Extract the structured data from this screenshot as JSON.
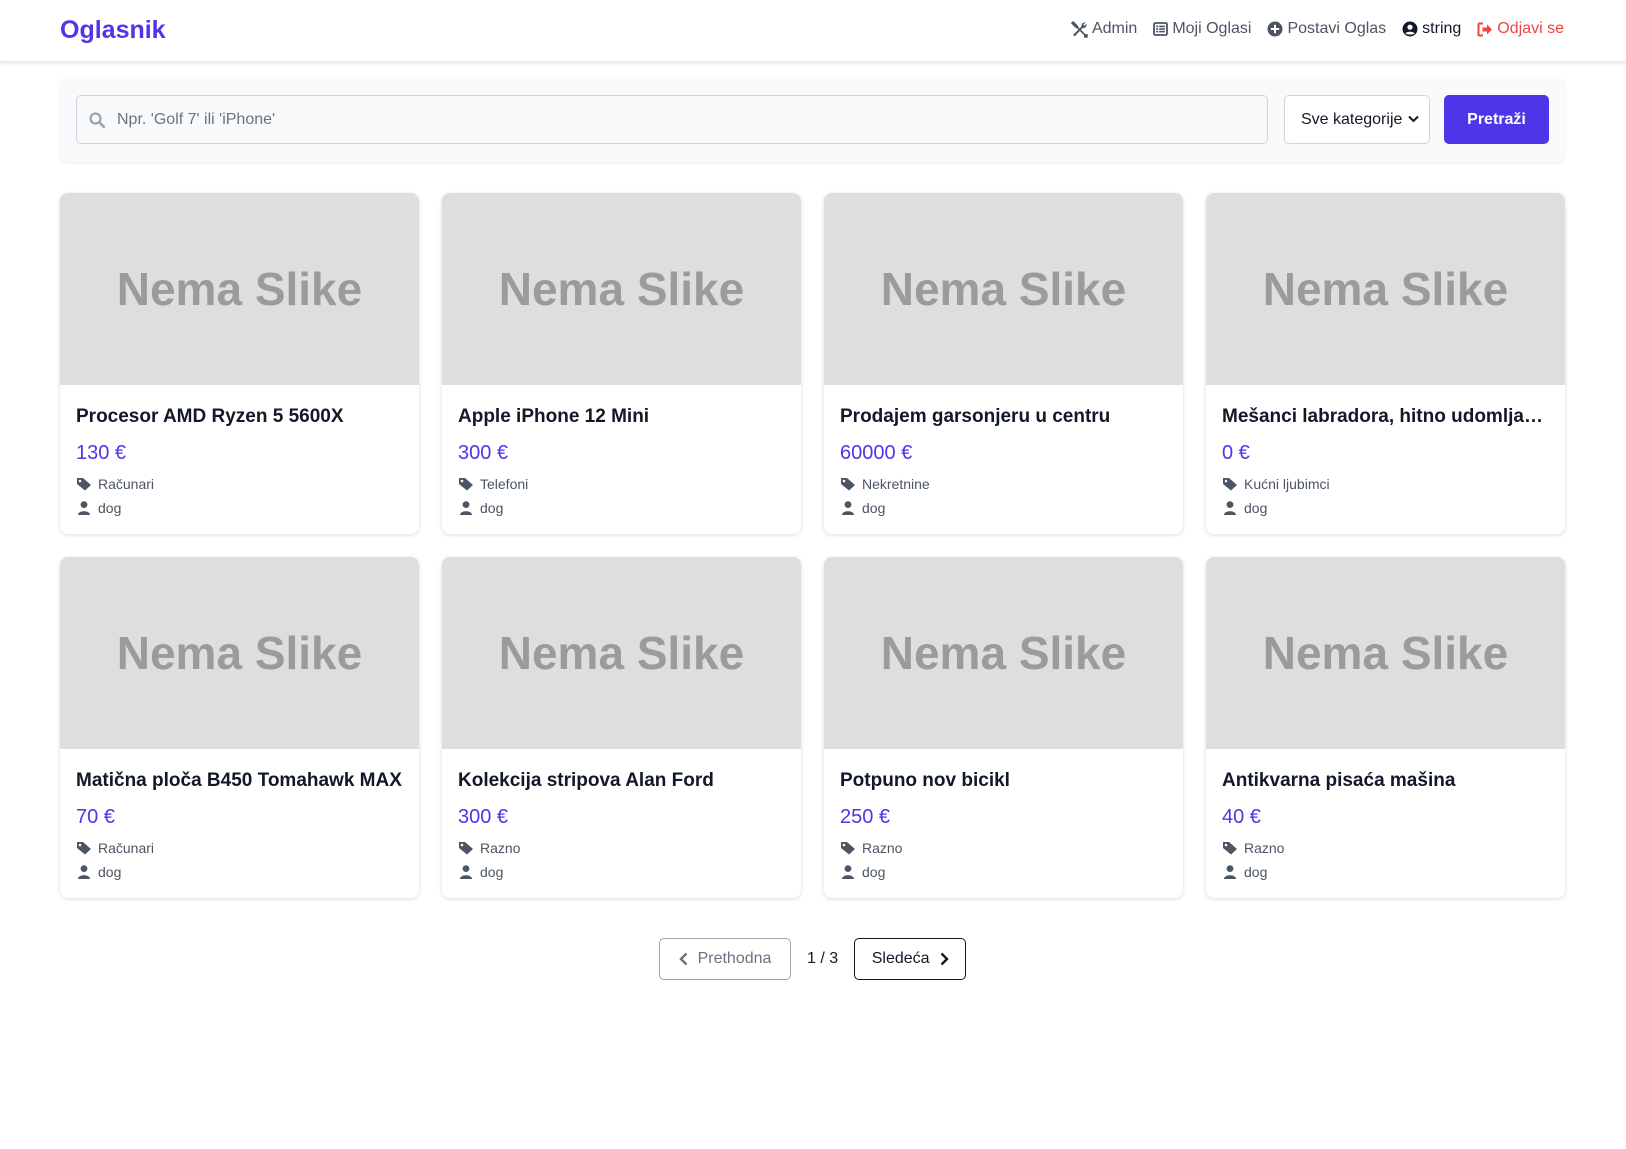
{
  "navbar": {
    "brand": "Oglasnik",
    "links": {
      "admin": "Admin",
      "my_ads": "Moji Oglasi",
      "post_ad": "Postavi Oglas",
      "user": "string",
      "logout": "Odjavi se"
    }
  },
  "search": {
    "placeholder": "Npr. 'Golf 7' ili 'iPhone'",
    "value": "",
    "category_selected": "Sve kategorije",
    "button_label": "Pretraži"
  },
  "listings": [
    {
      "thumb": "Nema Slike",
      "title": "Procesor AMD Ryzen 5 5600X",
      "price": "130 €",
      "category": "Računari",
      "owner": "dog"
    },
    {
      "thumb": "Nema Slike",
      "title": "Apple iPhone 12 Mini",
      "price": "300 €",
      "category": "Telefoni",
      "owner": "dog"
    },
    {
      "thumb": "Nema Slike",
      "title": "Prodajem garsonjeru u centru",
      "price": "60000 €",
      "category": "Nekretnine",
      "owner": "dog"
    },
    {
      "thumb": "Nema Slike",
      "title": "Mešanci labradora, hitno udomljavanje",
      "price": "0 €",
      "category": "Kućni ljubimci",
      "owner": "dog"
    },
    {
      "thumb": "Nema Slike",
      "title": "Matična ploča B450 Tomahawk MAX",
      "price": "70 €",
      "category": "Računari",
      "owner": "dog"
    },
    {
      "thumb": "Nema Slike",
      "title": "Kolekcija stripova Alan Ford",
      "price": "300 €",
      "category": "Razno",
      "owner": "dog"
    },
    {
      "thumb": "Nema Slike",
      "title": "Potpuno nov bicikl",
      "price": "250 €",
      "category": "Razno",
      "owner": "dog"
    },
    {
      "thumb": "Nema Slike",
      "title": "Antikvarna pisaća mašina",
      "price": "40 €",
      "category": "Razno",
      "owner": "dog"
    }
  ],
  "pagination": {
    "prev_label": "Prethodna",
    "page_info": "1 / 3",
    "next_label": "Sledeća"
  },
  "colors": {
    "accent": "#4f35e8",
    "logout": "#ef4444",
    "placeholder_bg": "#dedede",
    "placeholder_text": "#9b9b9b"
  },
  "icons": {
    "admin": "tools-icon",
    "my_ads": "list-icon",
    "post_ad": "plus-circle-icon",
    "user": "user-circle-icon",
    "logout": "sign-out-icon",
    "search": "search-icon",
    "category": "tag-icon",
    "owner": "user-icon",
    "prev": "chevron-left-icon",
    "next": "chevron-right-icon"
  }
}
